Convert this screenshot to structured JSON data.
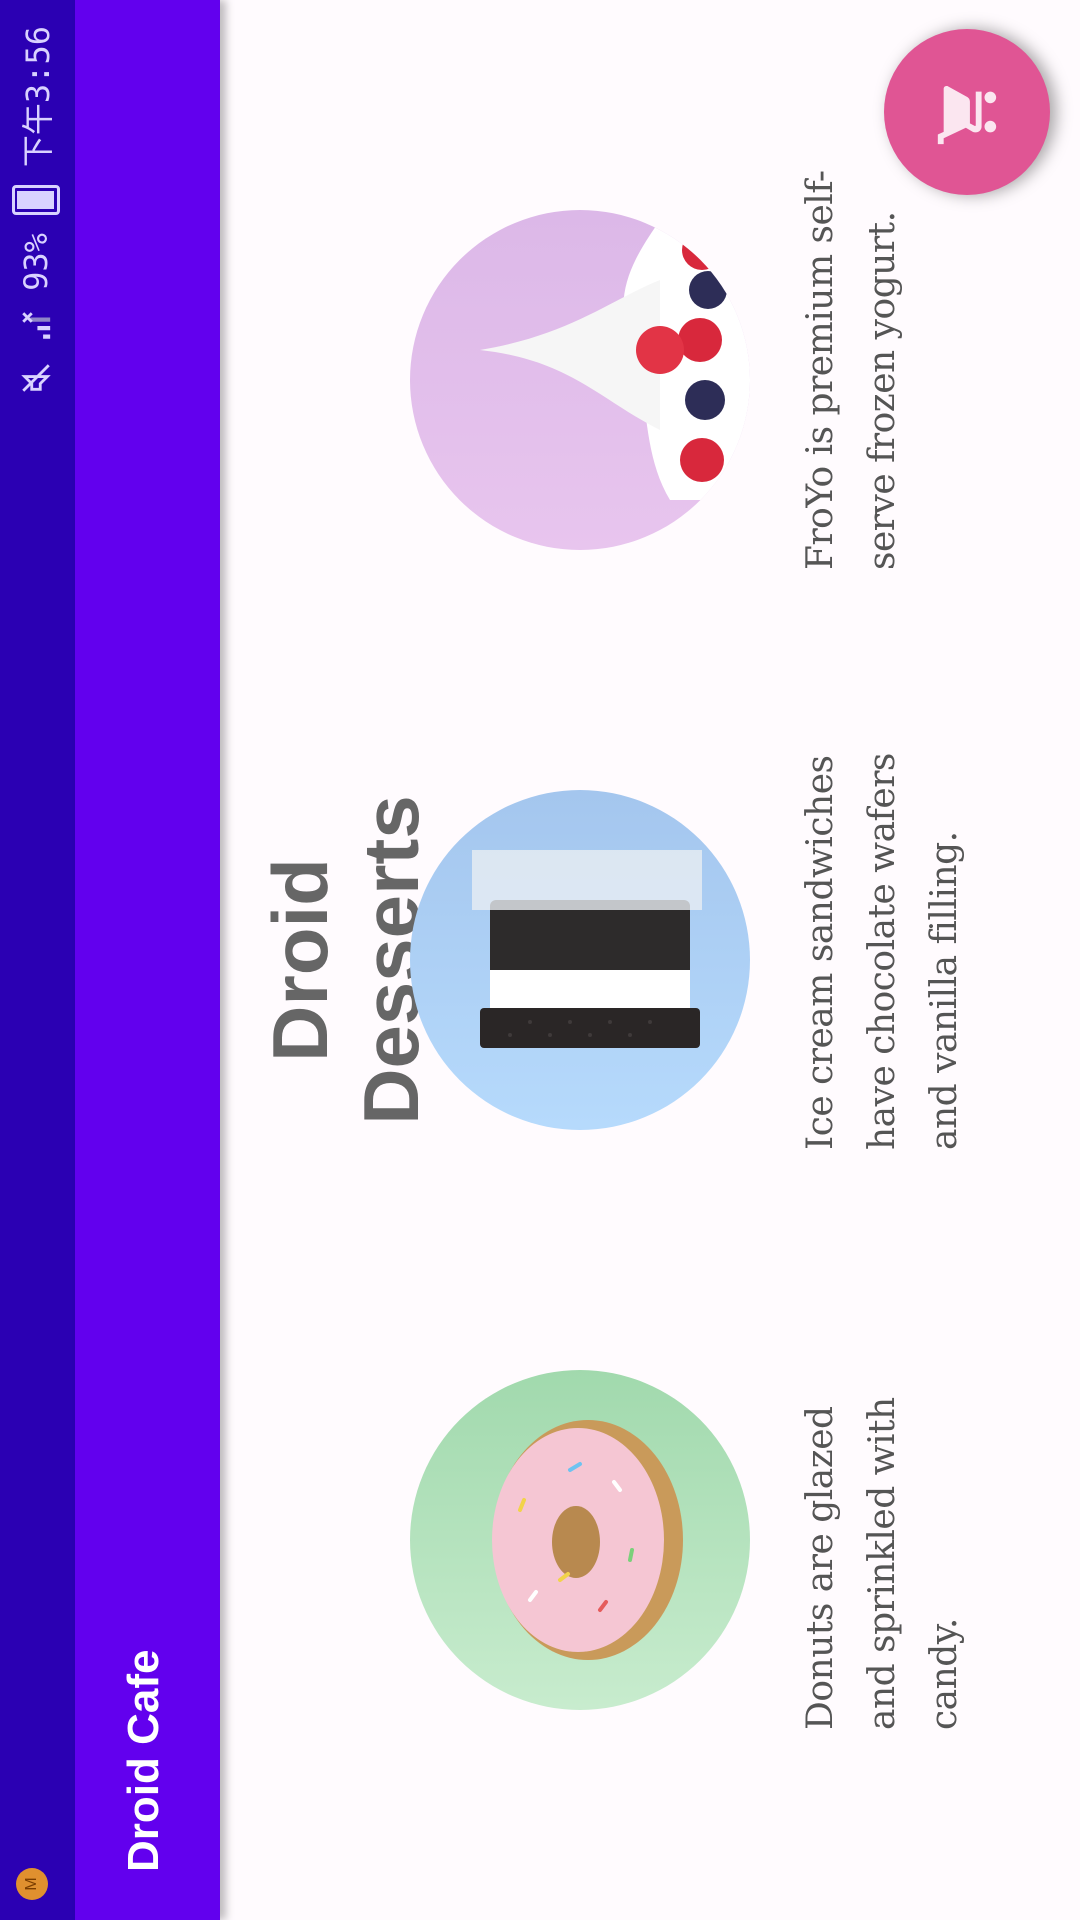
{
  "status_bar": {
    "time": "下午3:56",
    "battery": "93%",
    "battery_level": 0.93,
    "icons": [
      "notification-app-icon",
      "mute-icon",
      "signal-icon",
      "battery-icon"
    ]
  },
  "app_bar": {
    "title": "Droid Cafe"
  },
  "main": {
    "heading": "Droid Desserts",
    "items": [
      {
        "name": "donut",
        "description": "Donuts are glazed and sprinkled with candy.",
        "bg": "#a8dcb3"
      },
      {
        "name": "ice-cream-sandwich",
        "description": "Ice cream sandwiches have chocolate wafers and vanilla filling.",
        "bg": "#a9cdf3"
      },
      {
        "name": "froyo",
        "description": "FroYo is premium self-serve frozen yogurt.",
        "bg": "#dcb8e8"
      }
    ]
  },
  "fab": {
    "icon": "shopping-cart-icon",
    "color": "#e05594"
  },
  "colors": {
    "status_bar": "#2b00b3",
    "app_bar": "#6200ee",
    "background": "#fffbfe"
  }
}
